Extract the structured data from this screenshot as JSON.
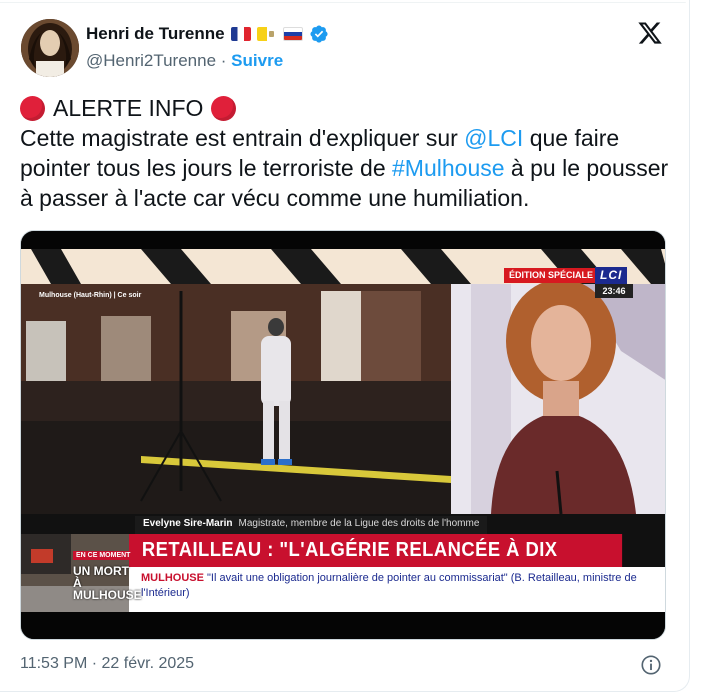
{
  "author": {
    "display_name": "Henri de Turenne",
    "handle": "@Henri2Turenne",
    "separator": "·",
    "follow_label": "Suivre",
    "flags": [
      "flag-france",
      "flag-vatican",
      "flag-russia"
    ],
    "verified_color": "#1d9bf0"
  },
  "tweet": {
    "alert": "ALERTE INFO",
    "text_part1": "Cette magistrate est entrain d'expliquer sur ",
    "mention_lci": "@LCI",
    "text_part2": " que faire pointer tous les jours le terroriste de ",
    "hashtag": "#Mulhouse",
    "text_part3": " à pu le pousser à passer à l'acte car vécu comme une humiliation."
  },
  "media": {
    "place_tag": "Mulhouse (Haut-Rhin)  |  Ce soir",
    "edition": "ÉDITION SPÉCIALE",
    "channel": "LCI",
    "clock": "23:46",
    "speaker_name": "Evelyne Sire-Marin",
    "speaker_role": "Magistrate, membre de la Ligue des droits de l'homme",
    "headline": "RETAILLEAU : \"L'ALGÉRIE RELANCÉE À DIX REPRISES\"",
    "sub_city": "MULHOUSE",
    "sub_quote": "\"Il avait une obligation journalière de pointer au commissariat\" (B. Retailleau, ministre de l'Intérieur)",
    "inset_tag": "EN CE MOMENT",
    "inset_title": "UN MORT À MULHOUSE",
    "colors": {
      "headline_red": "#c8102e",
      "lci_blue": "#1b2a8f"
    }
  },
  "footer": {
    "time": "11:53 PM",
    "separator": "·",
    "date": "22 févr. 2025"
  },
  "colors": {
    "link": "#1d9bf0",
    "muted": "#536471",
    "text": "#0f1419",
    "alert_red": "#e0203a"
  }
}
